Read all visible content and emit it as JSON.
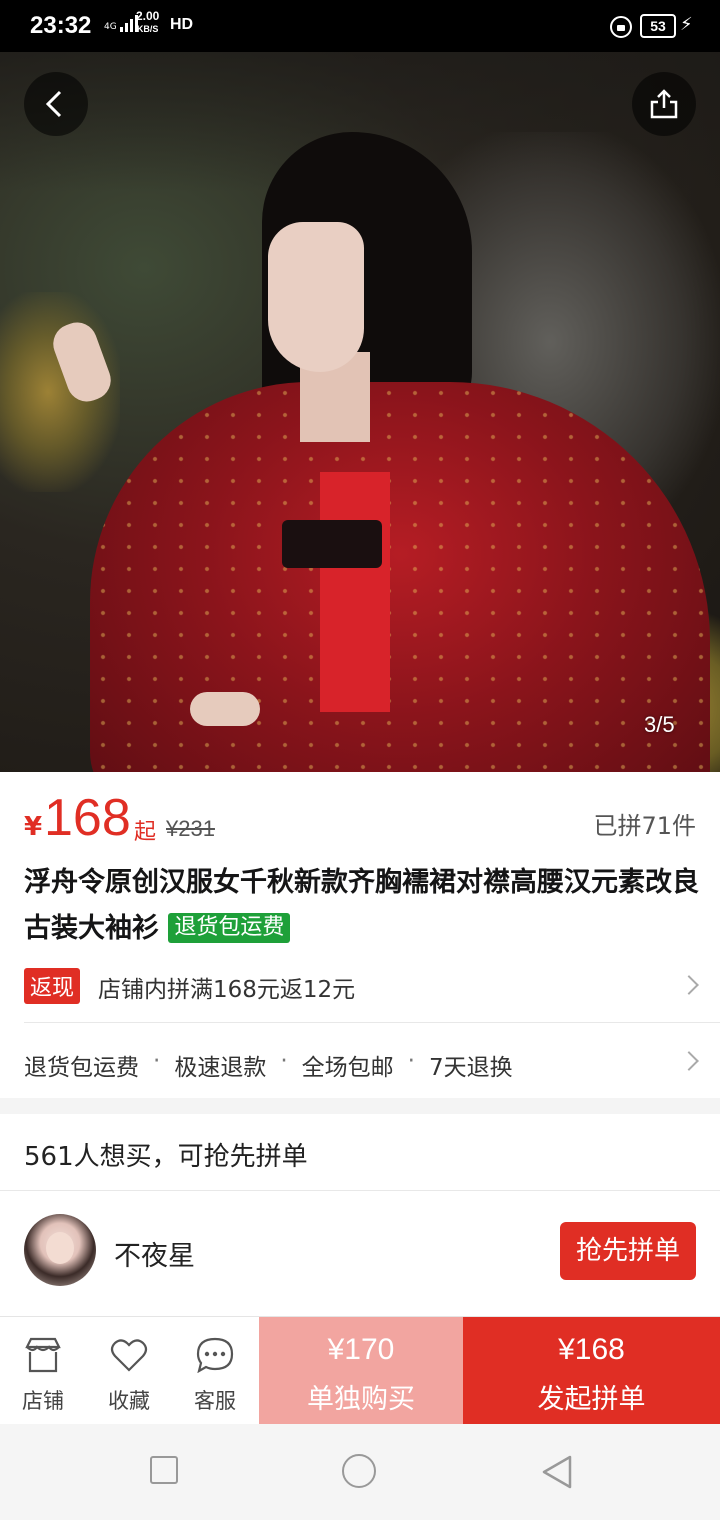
{
  "status_bar": {
    "time": "23:32",
    "network": "4G",
    "speed_value": "2.00",
    "speed_unit": "KB/S",
    "hd": "HD",
    "battery": "53"
  },
  "gallery": {
    "counter": "3/5",
    "current_image": 3,
    "total_images": 5
  },
  "price": {
    "currency": "¥",
    "value": "168",
    "suffix": "起",
    "original": "¥231",
    "sold": "已拼71件"
  },
  "product": {
    "title": "浮舟令原创汉服女千秋新款齐胸襦裙对襟高腰汉元素改良古装大袖衫",
    "tag": "退货包运费"
  },
  "promo": {
    "badge": "返现",
    "text": "店铺内拼满168元返12元"
  },
  "services": {
    "items": [
      "退货包运费",
      "极速退款",
      "全场包邮",
      "7天退换"
    ],
    "separator": "·"
  },
  "group": {
    "want_text": "561人想买，可抢先拼单",
    "nickname": "不夜星",
    "join_label": "抢先拼单"
  },
  "bottom_bar": {
    "store_label": "店铺",
    "favorite_label": "收藏",
    "service_label": "客服",
    "buy_alone_price": "¥170",
    "buy_alone_label": "单独购买",
    "buy_group_price": "¥168",
    "buy_group_label": "发起拼单"
  },
  "colors": {
    "accent": "#e02e24",
    "accent_light": "#f2a5a0",
    "tag_green": "#1ea039"
  }
}
